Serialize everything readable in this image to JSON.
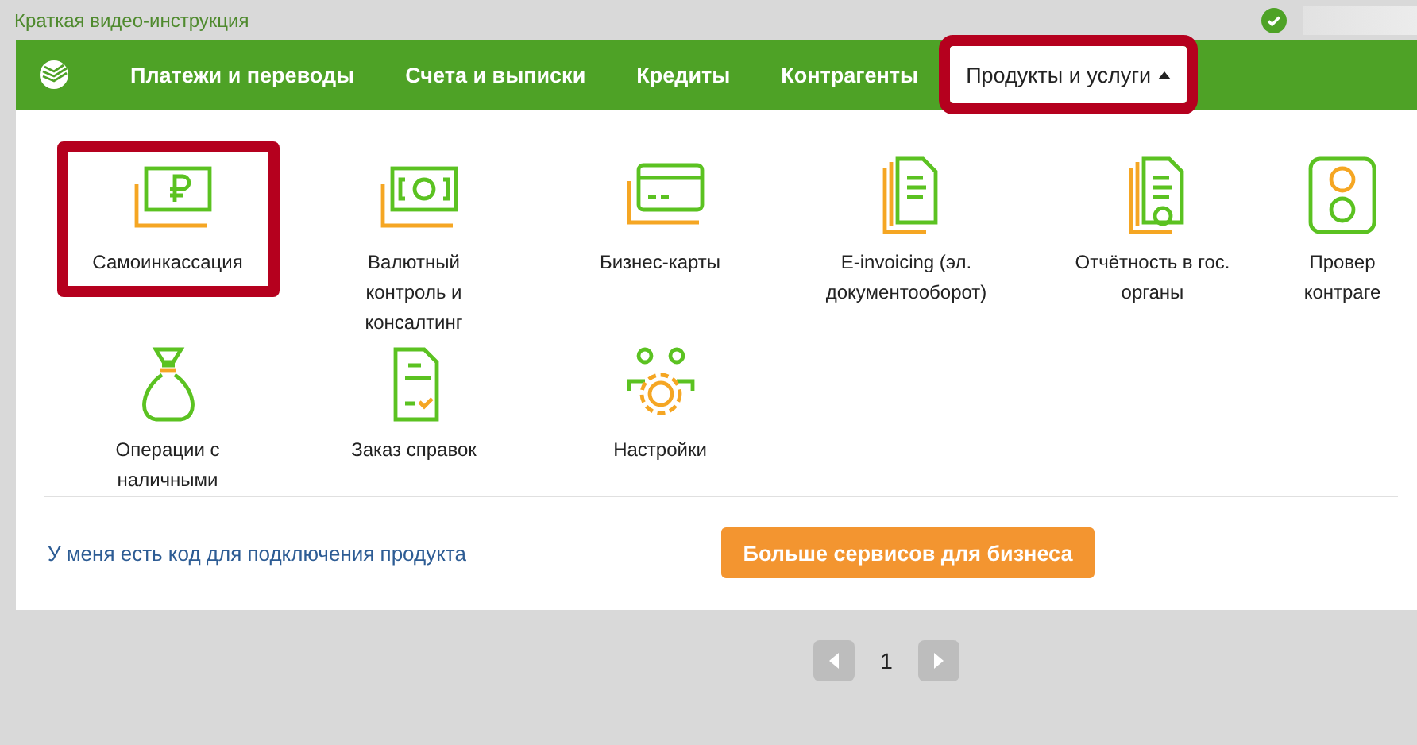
{
  "top_bar": {
    "link": "Краткая видео-инструкция",
    "status_ok": true
  },
  "nav": {
    "tabs": [
      {
        "label": "Платежи и переводы",
        "selected": false,
        "highlighted": false
      },
      {
        "label": "Счета и выписки",
        "selected": false,
        "highlighted": false
      },
      {
        "label": "Кредиты",
        "selected": false,
        "highlighted": false
      },
      {
        "label": "Контрагенты",
        "selected": false,
        "highlighted": false
      },
      {
        "label": "Продукты и услуги",
        "selected": true,
        "highlighted": true
      }
    ]
  },
  "products": [
    {
      "kind": "cash",
      "lines": [
        "Самоинкассация"
      ],
      "highlighted": true
    },
    {
      "kind": "currency",
      "lines": [
        "Валютный",
        "контроль и",
        "консалтинг"
      ],
      "highlighted": false
    },
    {
      "kind": "card",
      "lines": [
        "Бизнес-карты"
      ],
      "highlighted": false
    },
    {
      "kind": "documents",
      "lines": [
        "E-invoicing (эл.",
        "документооборот)"
      ],
      "highlighted": false
    },
    {
      "kind": "certificate",
      "lines": [
        "Отчётность в гос.",
        "органы"
      ],
      "highlighted": false
    },
    {
      "kind": "check",
      "lines": [
        "Провер",
        "контраге"
      ],
      "highlighted": false
    },
    {
      "kind": "bag",
      "lines": [
        "Операции с",
        "наличными"
      ],
      "highlighted": false
    },
    {
      "kind": "order",
      "lines": [
        "Заказ справок"
      ],
      "highlighted": false
    },
    {
      "kind": "settings",
      "lines": [
        "Настройки"
      ],
      "highlighted": false
    }
  ],
  "footer": {
    "link": "У меня есть код для подключения продукта",
    "button": "Больше сервисов для бизнеса"
  },
  "pagination": {
    "prev_disabled": true,
    "next_disabled": true,
    "page": "1"
  }
}
